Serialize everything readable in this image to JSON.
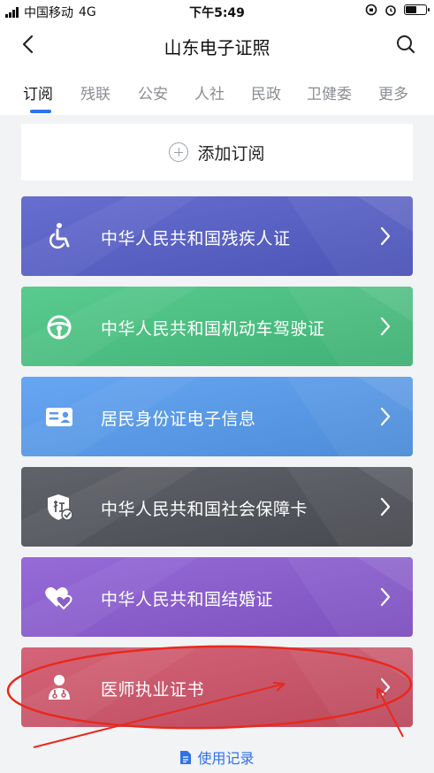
{
  "status_bar": {
    "carrier": "中国移动",
    "network": "4G",
    "time": "下午5:49",
    "battery_level": 0.55
  },
  "nav": {
    "title": "山东电子证照",
    "back_icon": "chevron-left-icon",
    "search_icon": "search-icon"
  },
  "tabs": [
    {
      "label": "订阅",
      "active": true
    },
    {
      "label": "残联"
    },
    {
      "label": "公安"
    },
    {
      "label": "人社"
    },
    {
      "label": "民政"
    },
    {
      "label": "卫健委"
    },
    {
      "label": "更多"
    }
  ],
  "add_subscription": {
    "label": "添加订阅"
  },
  "cards": [
    {
      "label": "中华人民共和国残疾人证",
      "icon": "wheelchair-icon",
      "color": "#5a62c4"
    },
    {
      "label": "中华人民共和国机动车驾驶证",
      "icon": "steering-wheel-icon",
      "color": "#4ebf82"
    },
    {
      "label": "居民身份证电子信息",
      "icon": "id-card-icon",
      "color": "#5a9ae6"
    },
    {
      "label": "中华人民共和国社会保障卡",
      "icon": "shield-check-icon",
      "color": "#55575e"
    },
    {
      "label": "中华人民共和国结婚证",
      "icon": "hearts-icon",
      "color": "#8a5fcc"
    },
    {
      "label": "医师执业证书",
      "icon": "doctor-icon",
      "color": "#c9586c"
    }
  ],
  "footer": {
    "usage_link": "使用记录"
  },
  "annotation": {
    "color": "#e8291e"
  }
}
